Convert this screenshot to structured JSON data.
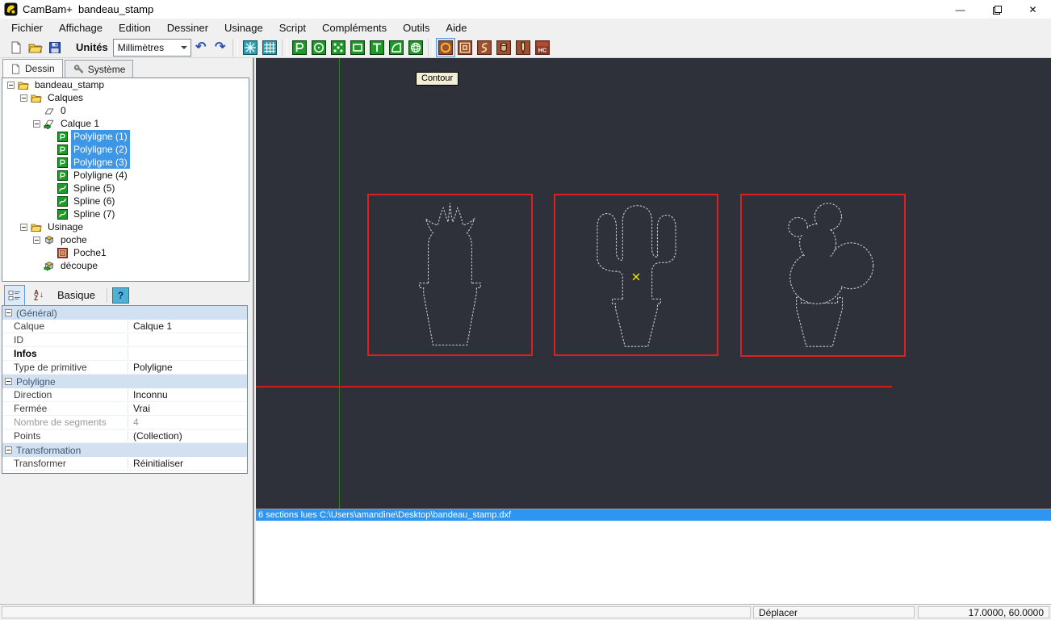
{
  "window": {
    "app_title": "CamBam+  bandeau_stamp"
  },
  "menu": {
    "items": [
      {
        "id": "fichier",
        "label": "Fichier"
      },
      {
        "id": "affichage",
        "label": "Affichage"
      },
      {
        "id": "edition",
        "label": "Edition"
      },
      {
        "id": "dessiner",
        "label": "Dessiner"
      },
      {
        "id": "usinage",
        "label": "Usinage"
      },
      {
        "id": "script",
        "label": "Script"
      },
      {
        "id": "complements",
        "label": "Compléments"
      },
      {
        "id": "outils",
        "label": "Outils"
      },
      {
        "id": "aide",
        "label": "Aide"
      }
    ]
  },
  "toolbar": {
    "units_label": "Unités",
    "units_value": "Millimètres",
    "buttons": [
      {
        "id": "new-file",
        "icon": "new"
      },
      {
        "id": "open-file",
        "icon": "open"
      },
      {
        "id": "save-file",
        "icon": "save"
      },
      {
        "type": "units"
      },
      {
        "type": "combo"
      },
      {
        "id": "undo",
        "icon": "undo"
      },
      {
        "id": "redo",
        "icon": "redo"
      },
      {
        "type": "sep"
      },
      {
        "id": "snap-points",
        "icon": "snap"
      },
      {
        "id": "show-grid",
        "icon": "grid"
      },
      {
        "type": "sep"
      },
      {
        "id": "draw-polyline",
        "icon": "d-polyline"
      },
      {
        "id": "draw-circle",
        "icon": "d-circle"
      },
      {
        "id": "draw-points",
        "icon": "d-points"
      },
      {
        "id": "draw-rectangle",
        "icon": "d-rect"
      },
      {
        "id": "draw-text",
        "icon": "d-text"
      },
      {
        "id": "draw-surface",
        "icon": "d-surface"
      },
      {
        "id": "draw-mesh",
        "icon": "d-mesh"
      },
      {
        "type": "sep"
      },
      {
        "id": "mop-contour",
        "icon": "m-contour",
        "selected": true
      },
      {
        "id": "mop-pocket",
        "icon": "m-pocket"
      },
      {
        "id": "mop-engrave",
        "icon": "m-engrave"
      },
      {
        "id": "mop-drill",
        "icon": "m-drill"
      },
      {
        "id": "mop-profile",
        "icon": "m-mill"
      },
      {
        "id": "mop-heightmap",
        "icon": "m-hc"
      }
    ]
  },
  "panel": {
    "tabs": [
      {
        "id": "dessin",
        "label": "Dessin",
        "icon": "page",
        "active": true
      },
      {
        "id": "systeme",
        "label": "Système",
        "icon": "wrench",
        "active": false
      }
    ],
    "tree": [
      {
        "label": "bandeau_stamp",
        "icon": "folder",
        "depth": 0,
        "expander": true
      },
      {
        "label": "Calques",
        "icon": "folder",
        "depth": 1,
        "expander": true
      },
      {
        "label": "0",
        "icon": "layer",
        "depth": 2
      },
      {
        "label": "Calque 1",
        "icon": "layer-active",
        "depth": 2,
        "expander": true
      },
      {
        "label": "Polyligne (1)",
        "icon": "polyline",
        "depth": 3,
        "selected": true
      },
      {
        "label": "Polyligne (2)",
        "icon": "polyline",
        "depth": 3,
        "selected": true
      },
      {
        "label": "Polyligne (3)",
        "icon": "polyline",
        "depth": 3,
        "selected": true
      },
      {
        "label": "Polyligne (4)",
        "icon": "polyline",
        "depth": 3
      },
      {
        "label": "Spline (5)",
        "icon": "spline",
        "depth": 3
      },
      {
        "label": "Spline (6)",
        "icon": "spline",
        "depth": 3
      },
      {
        "label": "Spline (7)",
        "icon": "spline",
        "depth": 3
      },
      {
        "label": "Usinage",
        "icon": "folder",
        "depth": 1,
        "expander": true
      },
      {
        "label": "poche",
        "icon": "box",
        "depth": 2,
        "expander": true
      },
      {
        "label": "Poche1",
        "icon": "pocket",
        "depth": 3
      },
      {
        "label": "découpe",
        "icon": "box-arrow",
        "depth": 2
      }
    ],
    "prop_toolbar": {
      "basic_label": "Basique",
      "help_label": "?"
    },
    "properties": [
      {
        "type": "category",
        "label": "(Général)"
      },
      {
        "type": "row",
        "name": "Calque",
        "value": "Calque 1"
      },
      {
        "type": "row",
        "name": "ID",
        "value": ""
      },
      {
        "type": "row",
        "name": "Infos",
        "value": "",
        "bold": true
      },
      {
        "type": "row",
        "name": "Type de primitive",
        "value": "Polyligne"
      },
      {
        "type": "category",
        "label": "Polyligne"
      },
      {
        "type": "row",
        "name": "Direction",
        "value": "Inconnu"
      },
      {
        "type": "row",
        "name": "Fermée",
        "value": "Vrai"
      },
      {
        "type": "row",
        "name": "Nombre de segments",
        "value": "4",
        "disabled": true
      },
      {
        "type": "row",
        "name": "Points",
        "value": "(Collection)"
      },
      {
        "type": "category",
        "label": "Transformation"
      },
      {
        "type": "row",
        "name": "Transformer",
        "value": "Réinitialiser"
      }
    ]
  },
  "canvas": {
    "tooltip": "Contour",
    "log_line": "6 sections lues C:\\Users\\amandine\\Desktop\\bandeau_stamp.dxf",
    "colors": {
      "background": "#2e313a",
      "selection_red": "#dc1f1f",
      "axis_green": "#2d7d2d",
      "outline_gray": "#c9ccd6",
      "marker_yellow": "#e8e800",
      "selection_blue": "#3e97e6"
    }
  },
  "status_bar": {
    "tool_hint": "Déplacer",
    "coordinates": "17.0000, 60.0000"
  }
}
